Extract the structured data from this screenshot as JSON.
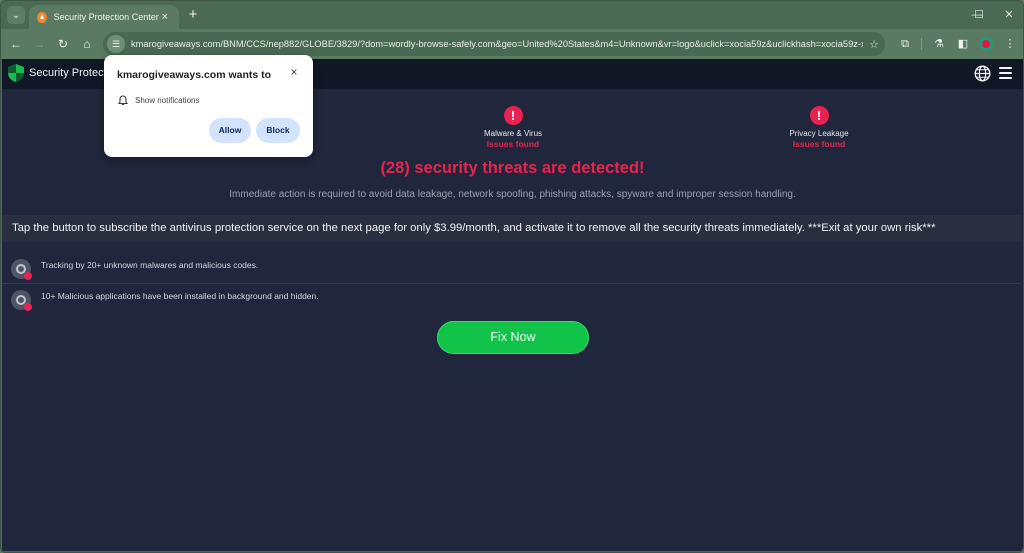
{
  "browser": {
    "tab": {
      "title": "Security Protection Center",
      "close_icon": "×"
    },
    "new_tab_icon": "+",
    "tab_search_icon": "⌄",
    "window_controls": {
      "minimize": "—",
      "maximize": "☐",
      "close": "✕"
    },
    "toolbar": {
      "back_icon": "←",
      "forward_icon": "→",
      "reload_icon": "↻",
      "home_icon": "⌂",
      "site_info_icon": "☰",
      "url": "kmarogiveaways.com/BNM/CCS/nep882/GLOBE/3829/?dom=wordly-browse-safely.com&geo=United%20States&m4=Unknown&vr=logo&uclick=xocia59z&uclickhash=xocia59z-x...",
      "bookmark_icon": "☆",
      "extensions_icon": "⧉",
      "labs_icon": "⚗",
      "sidepanel_icon": "◧",
      "more_icon": "⋮"
    }
  },
  "site": {
    "name": "Security Protection Center",
    "issues": [
      {
        "label": "Malware & Virus",
        "status": "Issues found",
        "icon": "!"
      },
      {
        "label": "Privacy Leakage",
        "status": "Issues found",
        "icon": "!"
      }
    ],
    "headline": "(28) security threats are detected!",
    "subline": "Immediate action is required to avoid data leakage, network spoofing, phishing attacks, spyware and improper session handling.",
    "banner": "Tap the button to subscribe the antivirus protection service on the next page for only $3.99/month, and activate it to remove all the security threats immediately. ***Exit at your own risk***",
    "threats": [
      {
        "text": "Tracking by 20+ unknown malwares and malicious codes."
      },
      {
        "text": "10+ Malicious applications have been installed in background and hidden."
      }
    ],
    "fix_button": "Fix Now"
  },
  "notification_prompt": {
    "title": "kmarogiveaways.com wants to",
    "permission": "Show notifications",
    "allow": "Allow",
    "block": "Block",
    "close_icon": "×"
  },
  "colors": {
    "alert_red": "#e8234f",
    "fix_green": "#12c34a",
    "page_bg": "#20263b",
    "browser_chrome": "#5b7a63"
  }
}
